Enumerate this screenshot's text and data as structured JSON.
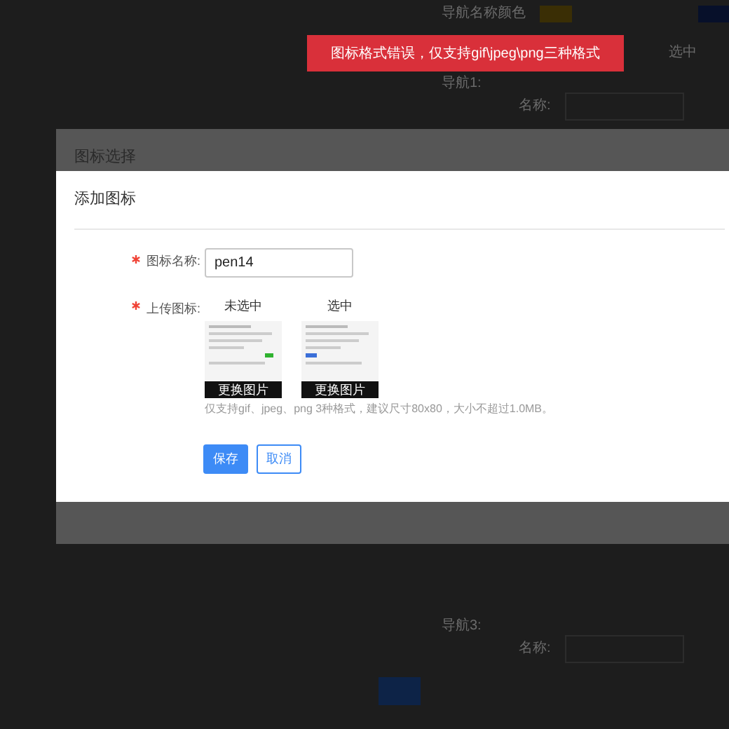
{
  "background": {
    "color_label": "导航名称颜色",
    "selected_header": "选中",
    "nav_groups": [
      {
        "label": "导航1:",
        "field_label": "名称:"
      },
      {
        "label": "导航3:",
        "field_label": "名称:"
      }
    ]
  },
  "toast": {
    "message": "图标格式错误，仅支持gif\\jpeg\\png三种格式"
  },
  "outer_dialog": {
    "title": "图标选择"
  },
  "dialog": {
    "title": "添加图标",
    "fields": [
      {
        "kind": "text",
        "label": "图标名称:",
        "required": true,
        "value": "pen14"
      },
      {
        "kind": "upload",
        "label": "上传图标:",
        "required": true,
        "slots": [
          {
            "caption": "未选中",
            "button": "更换图片"
          },
          {
            "caption": "选中",
            "button": "更换图片"
          }
        ],
        "hint": "仅支持gif、jpeg、png 3种格式，建议尺寸80x80，大小不超过1.0MB。"
      }
    ],
    "buttons": [
      {
        "label": "保存",
        "primary": true
      },
      {
        "label": "取消",
        "primary": false
      }
    ]
  }
}
